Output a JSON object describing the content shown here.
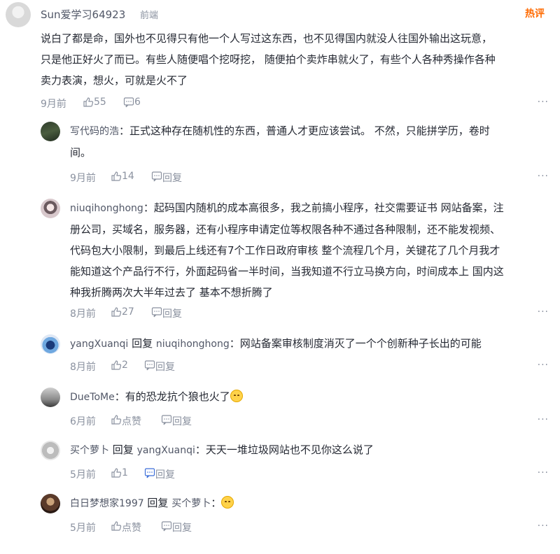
{
  "main": {
    "username": "Sun爱学习64923",
    "tag": "前端",
    "hot_label": "热评",
    "text_lines": [
      "说白了都是命，国外也不见得只有他一个人写过这东西，也不见得国内就没人往国外输出这玩意，",
      "只是他正好火了而已。有些人随便唱个挖呀挖，  随便拍个卖炸串就火了，有些个人各种秀操作各种",
      "卖力表演，想火，可就是火不了"
    ],
    "time": "9月前",
    "likes": "55",
    "comments": "6",
    "more": "···"
  },
  "replies": [
    {
      "username": "写代码的浩",
      "reply_label": "",
      "target": "",
      "text_lines": [
        "：正式这种存在随机性的东西，普通人才更应该尝试。 不然，只能拼学历，卷时",
        "间。"
      ],
      "time": "9月前",
      "likes": "14",
      "reply_btn": "回复",
      "more": "···"
    },
    {
      "username": "niuqihonghong",
      "reply_label": "",
      "target": "",
      "text_lines": [
        "：起码国内随机的成本高很多，我之前搞小程序，社交需要证书 网站备案，注",
        "册公司，买域名，服务器，还有小程序申请定位等权限各种不通过各种限制，还不能发视频、",
        "代码包大小限制，到最后上线还有7个工作日政府审核 整个流程几个月，关键花了几个月我才",
        "能知道这个产品行不行，外面起码省一半时间，当我知道不行立马换方向，时间成本上 国内这",
        "种我折腾两次大半年过去了 基本不想折腾了"
      ],
      "time": "8月前",
      "likes": "27",
      "reply_btn": "回复",
      "more": "···"
    },
    {
      "username": "yangXuanqi",
      "reply_label": "回复",
      "target": "niuqihonghong",
      "text_lines": [
        "：网站备案审核制度消灭了一个个创新种子长出的可能"
      ],
      "time": "8月前",
      "likes": "2",
      "reply_btn": "回复",
      "more": "···"
    },
    {
      "username": "DueToMe",
      "reply_label": "",
      "target": "",
      "text_lines": [
        "：有的恐龙抗个狼也火了"
      ],
      "time": "6月前",
      "likes": "点赞",
      "reply_btn": "回复",
      "more": "···"
    },
    {
      "username": "买个萝卜",
      "reply_label": "回复",
      "target": "yangXuanqi",
      "text_lines": [
        "：天天一堆垃圾网站也不见你这么说了"
      ],
      "time": "5月前",
      "likes": "1",
      "reply_btn": "回复",
      "more": "···"
    },
    {
      "username": "白日梦想家1997",
      "reply_label": "回复",
      "target": "买个萝卜",
      "text_lines": [
        "："
      ],
      "time": "5月前",
      "likes": "点赞",
      "reply_btn": "回复",
      "more": "···"
    }
  ],
  "colors": {
    "text": "#252933",
    "meta": "#8a919f",
    "name": "#515767",
    "hot": "#ff6a00"
  },
  "icons": {
    "like": "thumbs-up-icon",
    "comment": "comment-icon",
    "more": "more-dots-icon",
    "emoji": "smile-emoji-icon"
  }
}
